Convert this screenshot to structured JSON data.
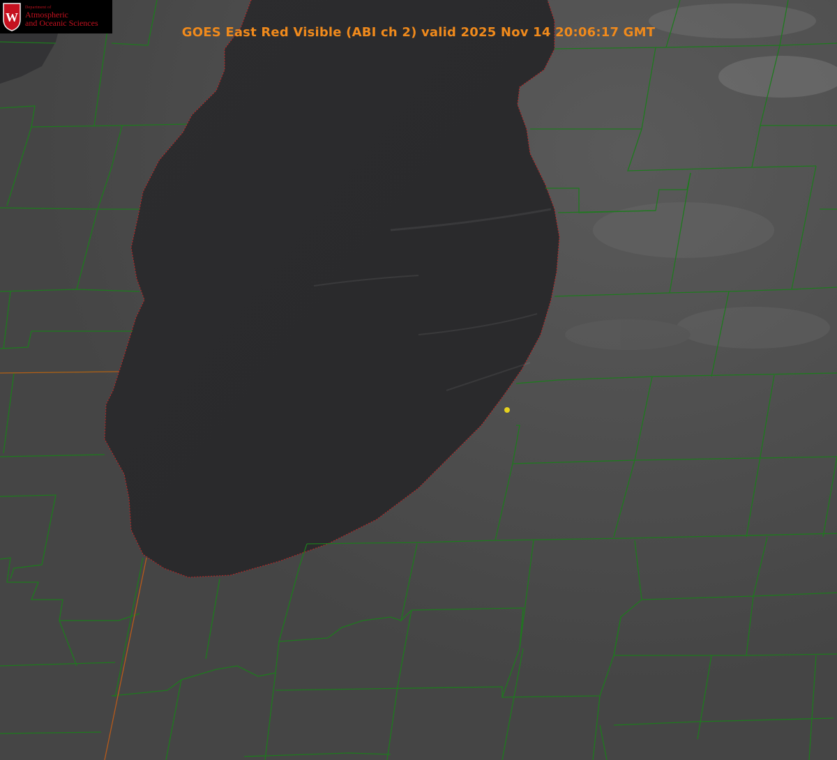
{
  "title": "GOES East Red Visible (ABI ch 2) valid 2025 Nov 14 20:06:17 GMT",
  "logo": {
    "department": "Department of",
    "line1": "Atmospheric",
    "line2": "and Oceanic Sciences",
    "crest_letter": "W"
  },
  "colors": {
    "county_lines": "#1e7a1e",
    "state_lines": "#b85a1a",
    "coastline": "#d02020",
    "title": "#f08a1c",
    "marker": "#e6d21e",
    "logo_text": "#c5111f",
    "land": "#4a4a4a",
    "lake": "#2a2a2c"
  }
}
